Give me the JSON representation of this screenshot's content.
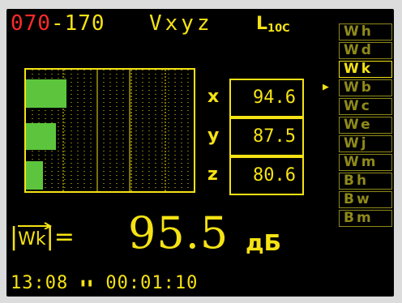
{
  "header": {
    "range_low": "070",
    "range_sep": "-",
    "range_high": "170",
    "axes": "Vxyz",
    "param_main": "L",
    "param_sub": "10C"
  },
  "bargraph": {
    "bars": [
      {
        "axis": "x",
        "level": 0.24
      },
      {
        "axis": "y",
        "level": 0.18
      },
      {
        "axis": "z",
        "level": 0.1
      }
    ],
    "bar_color": "#5cc53d"
  },
  "channels": [
    {
      "label": "x",
      "value": "94.6"
    },
    {
      "label": "y",
      "value": "87.5"
    },
    {
      "label": "z",
      "value": "80.6"
    }
  ],
  "menu": {
    "items": [
      "Wh",
      "Wd",
      "Wk",
      "Wb",
      "Wc",
      "We",
      "Wj",
      "Wm",
      "Bh",
      "Bw",
      "Bm"
    ],
    "selected_index": 2
  },
  "vector": {
    "symbol": "Wk",
    "eq": "|=",
    "value": "95.5",
    "unit": "дБ"
  },
  "footer": {
    "time": "13:08",
    "status_icon": "pause-icon",
    "elapsed": "00:01:10"
  },
  "colors": {
    "background": "#000000",
    "foreground": "#f5e214",
    "range_low": "#ff2a2a",
    "menu_inactive": "#8f8a1a"
  }
}
